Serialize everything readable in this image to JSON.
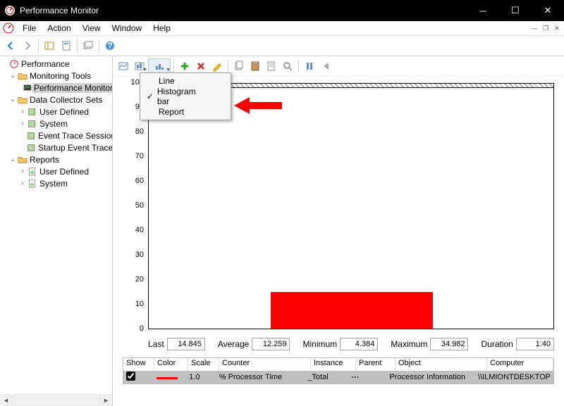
{
  "window": {
    "title": "Performance Monitor"
  },
  "menu": {
    "file": "File",
    "action": "Action",
    "view": "View",
    "window": "Window",
    "help": "Help"
  },
  "tree": {
    "root": "Performance",
    "monitoring_tools": "Monitoring Tools",
    "performance_monitor": "Performance Monitor",
    "data_collector_sets": "Data Collector Sets",
    "user_defined1": "User Defined",
    "system1": "System",
    "event_trace": "Event Trace Sessions",
    "startup_event_trace": "Startup Event Trace Sessions",
    "reports": "Reports",
    "user_defined2": "User Defined",
    "system2": "System"
  },
  "dropdown": {
    "line": "Line",
    "histogram": "Histogram bar",
    "report": "Report"
  },
  "chart_data": {
    "type": "bar",
    "categories": [
      "% Processor Time"
    ],
    "values": [
      14.8
    ],
    "title": "",
    "xlabel": "",
    "ylabel": "",
    "ylim": [
      0,
      100
    ],
    "ticks": [
      0,
      10,
      20,
      30,
      40,
      50,
      60,
      70,
      80,
      90,
      100
    ]
  },
  "stats": {
    "last_label": "Last",
    "last": "14.845",
    "avg_label": "Average",
    "avg": "12.259",
    "min_label": "Minimum",
    "min": "4.384",
    "max_label": "Maximum",
    "max": "34.982",
    "dur_label": "Duration",
    "dur": "1:40"
  },
  "counters": {
    "headers": {
      "show": "Show",
      "color": "Color",
      "scale": "Scale",
      "counter": "Counter",
      "instance": "Instance",
      "parent": "Parent",
      "object": "Object",
      "computer": "Computer"
    },
    "row": {
      "scale": "1.0",
      "counter": "% Processor Time",
      "instance": "_Total",
      "parent": "---",
      "object": "Processor Information",
      "computer": "\\\\ILMIONTDESKTOP"
    }
  }
}
